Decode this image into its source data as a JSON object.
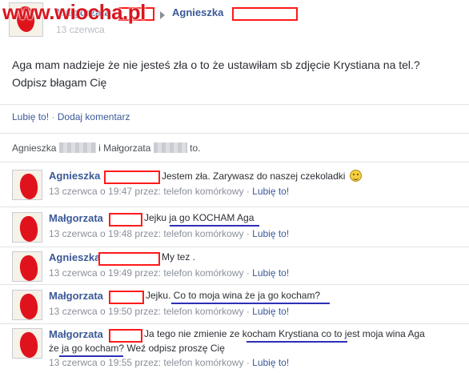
{
  "watermark": "www.wiocha.pl",
  "header": {
    "author": "Małgorzata",
    "recipient": "Agnieszka",
    "date": "13 czerwca"
  },
  "post": {
    "line1": "Aga mam nadzieje że nie jesteś zła o to że ustawiłam sb zdjęcie Krystiana na tel.?",
    "line2": "Odpisz błagam Cię"
  },
  "actions": {
    "like": "Lubię to!",
    "separator": "·",
    "comment": "Dodaj komentarz"
  },
  "likes": {
    "name1": "Agnieszka",
    "conj": "i",
    "name2": "Małgorzata",
    "suffix": "to."
  },
  "comments": [
    {
      "name": "Agnieszka",
      "text": "Jestem zła. Zarywasz do naszej czekoladki",
      "time": "13 czerwca o 19:47",
      "via": "przez: telefon komórkowy",
      "sep": "·",
      "like": "Lubię to!",
      "emoji": "smiley-icon"
    },
    {
      "name": "Małgorzata",
      "text": "Jejku ja go KOCHAM Aga",
      "time": "13 czerwca o 19:48",
      "via": "przez: telefon komórkowy",
      "sep": "·",
      "like": "Lubię to!"
    },
    {
      "name": "Agnieszka",
      "text": "My tez .",
      "time": "13 czerwca o 19:49",
      "via": "przez: telefon komórkowy",
      "sep": "·",
      "like": "Lubię to!"
    },
    {
      "name": "Małgorzata",
      "text": "Jejku. Co to moja wina że ja go kocham?",
      "time": "13 czerwca o 19:50",
      "via": "przez: telefon komórkowy",
      "sep": "·",
      "like": "Lubię to!"
    },
    {
      "name": "Małgorzata",
      "text": "Ja tego nie zmienie ze kocham Krystiana co to jest moja wina Aga",
      "text2": "że ja go kocham? Weź odpisz proszę Cię",
      "time": "13 czerwca o 19:55",
      "via": "przez: telefon komórkowy",
      "sep": "·",
      "like": "Lubię to!"
    }
  ],
  "colors": {
    "link": "#3b5998",
    "redaction": "#ff1a1a",
    "underline": "#2d2fb5",
    "watermark": "#d8161e"
  }
}
